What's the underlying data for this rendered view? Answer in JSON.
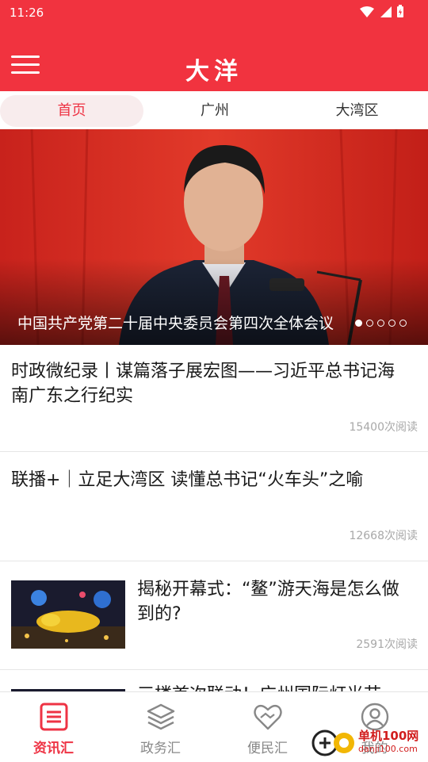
{
  "status_bar": {
    "time": "11:26"
  },
  "header": {
    "title": "大洋"
  },
  "tabs": [
    {
      "label": "首页",
      "active": true
    },
    {
      "label": "广州",
      "active": false
    },
    {
      "label": "大湾区",
      "active": false
    }
  ],
  "hero": {
    "caption": "中国共产党第二十届中央委员会第四次全体会议",
    "slide_count": 5,
    "active_slide": 1
  },
  "articles": [
    {
      "title": "时政微纪录丨谋篇落子展宏图——习近平总书记海南广东之行纪实",
      "reads": "15400次阅读"
    },
    {
      "title": "联播+｜立足大湾区 读懂总书记“火车头”之喻",
      "reads": "12668次阅读"
    },
    {
      "title": "揭秘开幕式：“鳌”游天海是怎么做到的?",
      "reads": "2591次阅读"
    },
    {
      "title": "三楼首次联动！广州国际灯光节"
    }
  ],
  "bottom_nav": [
    {
      "label": "资讯汇",
      "icon": "news-list-icon",
      "active": true
    },
    {
      "label": "政务汇",
      "icon": "layers-icon",
      "active": false
    },
    {
      "label": "便民汇",
      "icon": "heart-hands-icon",
      "active": false
    },
    {
      "label": "我的",
      "icon": "user-icon",
      "active": false
    }
  ],
  "watermark": {
    "line1": "单机100网",
    "line2": "danji100.com"
  },
  "colors": {
    "brand": "#f1333f",
    "accent": "#ee3344",
    "tab_active_bg": "#f8eced"
  }
}
